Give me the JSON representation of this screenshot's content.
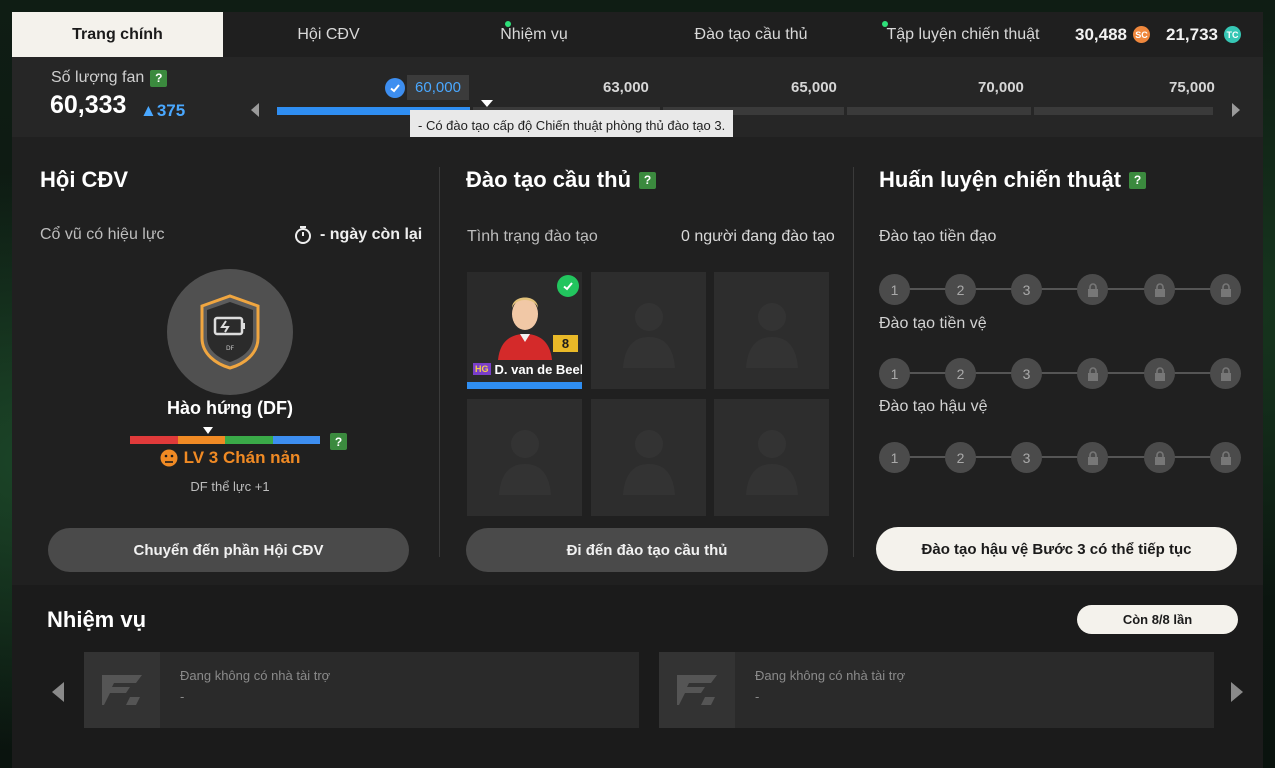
{
  "tabs": [
    {
      "label": "Trang chính",
      "active": true,
      "dot": false
    },
    {
      "label": "Hội CĐV",
      "active": false,
      "dot": false
    },
    {
      "label": "Nhiệm vụ",
      "active": false,
      "dot": true
    },
    {
      "label": "Đào tạo cầu thủ",
      "active": false,
      "dot": false
    },
    {
      "label": "Tập luyện chiến thuật",
      "active": false,
      "dot": true
    }
  ],
  "currency": {
    "sc_amount": "30,488",
    "sc_icon": "SC",
    "tc_amount": "21,733",
    "tc_icon": "TC"
  },
  "fans": {
    "label": "Số lượng fan",
    "help": "?",
    "count": "60,333",
    "increase": "▲375",
    "milestones": [
      "60,000",
      "63,000",
      "65,000",
      "70,000",
      "75,000"
    ],
    "progress_fraction": 0.11,
    "tooltip": "- Có đào tạo cấp độ Chiến thuật phòng thủ đào tạo 3."
  },
  "supporters": {
    "title": "Hội CĐV",
    "effect_label": "Cổ vũ có hiệu lực",
    "days_left": "- ngày còn lại",
    "badge_text": "DF",
    "mood_name": "Hào hứng (DF)",
    "mood_level": "LV 3 Chán nản",
    "mood_effect": "DF thể lực +1",
    "help": "?",
    "mood_colors": [
      "#e03a3a",
      "#f08a24",
      "#3aaa48",
      "#3d8ef0"
    ],
    "button": "Chuyển đến phần Hội CĐV"
  },
  "training": {
    "title": "Đào tạo cầu thủ",
    "help": "?",
    "status_label": "Tình trạng đào tạo",
    "count_label": "0 người đang đào tạo",
    "player": {
      "name": "D. van de Beek",
      "rating": "8",
      "tag": "HG"
    },
    "button": "Đi đến đào tạo cầu thủ"
  },
  "tactics": {
    "title": "Huấn luyện chiến thuật",
    "help": "?",
    "rows": [
      {
        "label": "Đào tạo tiền đạo",
        "nodes": [
          "1",
          "2",
          "3"
        ]
      },
      {
        "label": "Đào tạo tiền vệ",
        "nodes": [
          "1",
          "2",
          "3"
        ]
      },
      {
        "label": "Đào tạo hậu vệ",
        "nodes": [
          "1",
          "2",
          "3"
        ]
      }
    ],
    "button": "Đào tạo hậu vệ Bước 3 có thể tiếp tục"
  },
  "missions": {
    "title": "Nhiệm vụ",
    "remaining": "Còn 8/8 lần",
    "cards": [
      {
        "title": "Đang không có nhà tài trợ",
        "sub": "-"
      },
      {
        "title": "Đang không có nhà tài trợ",
        "sub": "-"
      }
    ]
  }
}
